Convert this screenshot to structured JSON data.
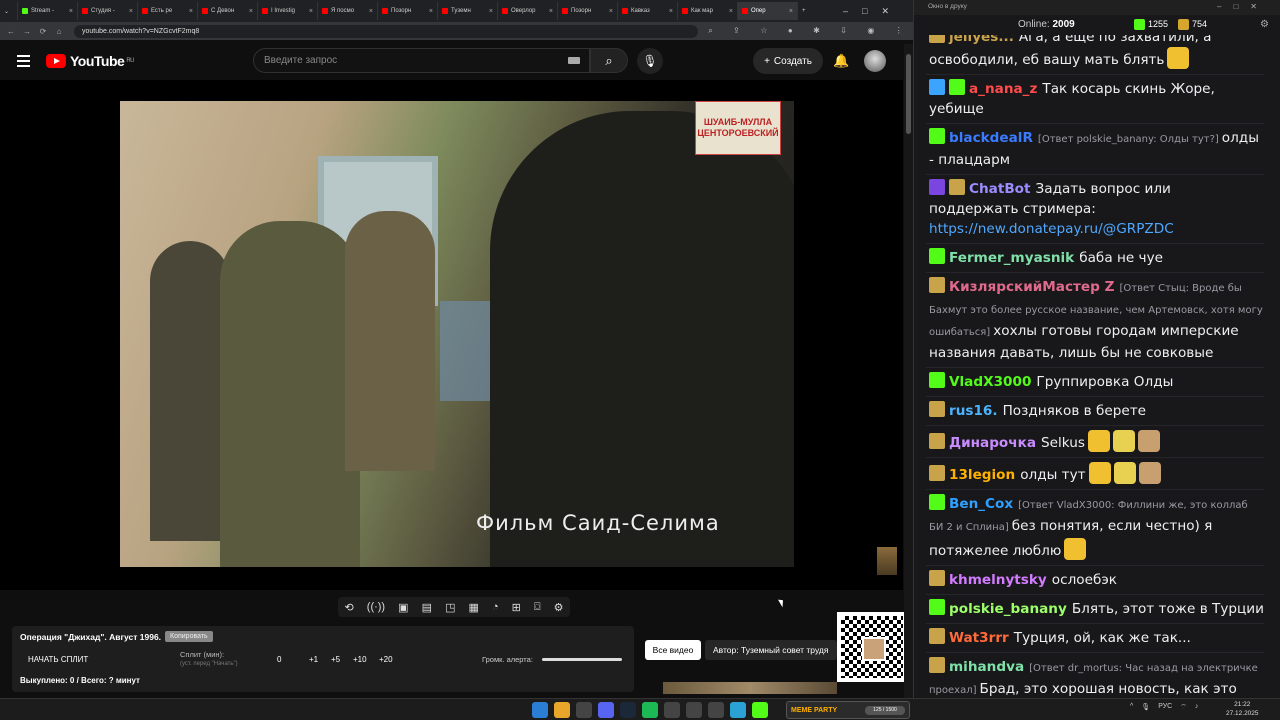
{
  "browser": {
    "tabs": [
      {
        "label": "Stream -",
        "icon": "kick-icon",
        "active": false
      },
      {
        "label": "Студия -",
        "icon": "youtube-icon",
        "active": false
      },
      {
        "label": "Есть ре",
        "icon": "youtube-icon",
        "active": false
      },
      {
        "label": "С Девон",
        "icon": "youtube-icon",
        "active": false
      },
      {
        "label": "I Investig",
        "icon": "youtube-icon",
        "active": false
      },
      {
        "label": "Я посмо",
        "icon": "youtube-icon",
        "active": false
      },
      {
        "label": "Позорн",
        "icon": "youtube-icon",
        "active": false
      },
      {
        "label": "Туземн",
        "icon": "youtube-icon",
        "active": false
      },
      {
        "label": "Оверлор",
        "icon": "youtube-icon",
        "active": false
      },
      {
        "label": "Позорн",
        "icon": "youtube-icon",
        "active": false
      },
      {
        "label": "Кавказ",
        "icon": "youtube-icon",
        "active": false
      },
      {
        "label": "Как мар",
        "icon": "youtube-icon",
        "active": false
      },
      {
        "label": "Опер",
        "icon": "youtube-icon",
        "active": true
      }
    ],
    "new_tab": "+",
    "url": "youtube.com/watch?v=NZGcvtF2mq8"
  },
  "youtube": {
    "logo_text": "YouTube",
    "region": "RU",
    "search_placeholder": "Введите запрос",
    "create_label": "Создать",
    "video_subtitle": "Фильм  Саид-Селима",
    "watermark_line1": "ШУАИБ-МУЛЛА",
    "watermark_line2": "ЦЕНТОРОЕВСКИЙ"
  },
  "panel": {
    "title": "Операция \"Джихад\". Август 1996.",
    "copy_label": "Копировать",
    "start_split": "НАЧАТЬ СПЛИТ",
    "split_label": "Сплит (мин):",
    "split_hint": "(уст. перед \"Начать\")",
    "split_value": "0",
    "increments": [
      "+1",
      "+5",
      "+10",
      "+20"
    ],
    "alert_label": "Громк. алерта:",
    "bought": "Выкуплено: 0 / Всего: ? минут",
    "all_videos": "Все видео",
    "author": "Автор: Туземный совет трудя"
  },
  "chat_window": {
    "title": "Окно в друку",
    "online_label": "Online:",
    "online_count": "2009",
    "kick_count": "1255",
    "crown_count": "754"
  },
  "chat": [
    {
      "badges": [
        "c"
      ],
      "nick": "jellyes...",
      "color": "#c9a34a",
      "reply": "",
      "text": "Ага, а ещё по захватили, а освободили, еб вашу мать блять",
      "emotes": 1
    },
    {
      "badges": [
        "s",
        "k"
      ],
      "nick": "a_nana_z",
      "color": "#ff4b4b",
      "reply": "",
      "text": "Так косарь скинь Жоре, уебище",
      "emotes": 0
    },
    {
      "badges": [
        "k"
      ],
      "nick": "blackdealR",
      "color": "#3a7bff",
      "reply": "[Ответ polskie_banany: Олды тут?]",
      "text": "олды - плацдарм",
      "emotes": 0
    },
    {
      "badges": [
        "i",
        "c"
      ],
      "nick": "ChatBot",
      "color": "#9b8cff",
      "reply": "",
      "text": "Задать вопрос или поддержать стримера:",
      "link": "https://new.donatepay.ru/@GRPZDC",
      "emotes": 0
    },
    {
      "badges": [
        "k"
      ],
      "nick": "Fermer_myasnik",
      "color": "#7fe0a8",
      "reply": "",
      "text": "баба не чуе",
      "emotes": 0
    },
    {
      "badges": [
        "c"
      ],
      "nick": "КизлярскийМастер Z",
      "color": "#e06a8c",
      "reply": "[Ответ Стыц: Вроде бы Бахмут это более русское название, чем Артемовск, хотя могу ошибаться]",
      "text": "хохлы готовы городам имперские названия давать, лишь бы не совковые",
      "emotes": 0
    },
    {
      "badges": [
        "k"
      ],
      "nick": "VladX3000",
      "color": "#53fc18",
      "reply": "",
      "text": "Группировка Олды",
      "emotes": 0
    },
    {
      "badges": [
        "c"
      ],
      "nick": "rus16.",
      "color": "#4ab4ff",
      "reply": "",
      "text": "Поздняков в берете",
      "emotes": 0
    },
    {
      "badges": [
        "c"
      ],
      "nick": "Динарочка",
      "color": "#c88cff",
      "reply": "",
      "text": "Selkus",
      "emotes": 3
    },
    {
      "badges": [
        "c"
      ],
      "nick": "13legion",
      "color": "#ffb100",
      "reply": "",
      "text": "олды тут",
      "emotes": 3
    },
    {
      "badges": [
        "k"
      ],
      "nick": "Ben_Cox",
      "color": "#2fa0ff",
      "reply": "[Ответ VladX3000: Филлини же, это коллаб БИ 2 и Сплина]",
      "text": "без понятия, если честно) я потяжелее люблю",
      "emotes": 1
    },
    {
      "badges": [
        "c"
      ],
      "nick": "khmelnytsky",
      "color": "#d27bff",
      "reply": "",
      "text": "ослоебэк",
      "emotes": 0
    },
    {
      "badges": [
        "k"
      ],
      "nick": "polskie_banany",
      "color": "#9cff6a",
      "reply": "",
      "text": "Блять, этот тоже в Турции",
      "emotes": 0
    },
    {
      "badges": [
        "c"
      ],
      "nick": "Wat3rrr",
      "color": "#ff6a3a",
      "reply": "",
      "text": "Турция, ой, как же так...",
      "emotes": 0
    },
    {
      "badges": [
        "c"
      ],
      "nick": "mihandva",
      "color": "#7fe0a8",
      "reply": "[Ответ dr_mortus: Час назад на электричке проехал]",
      "text": "Брад, это хорошая новость, как это связано с Димитровым/Мирноградом?",
      "emotes": 3
    }
  ],
  "taskbar": {
    "meme_label": "MEME PARTY",
    "meme_progress": "125 / 1500",
    "lang": "РУС",
    "time": "21:22",
    "date": "27.12.2025"
  }
}
